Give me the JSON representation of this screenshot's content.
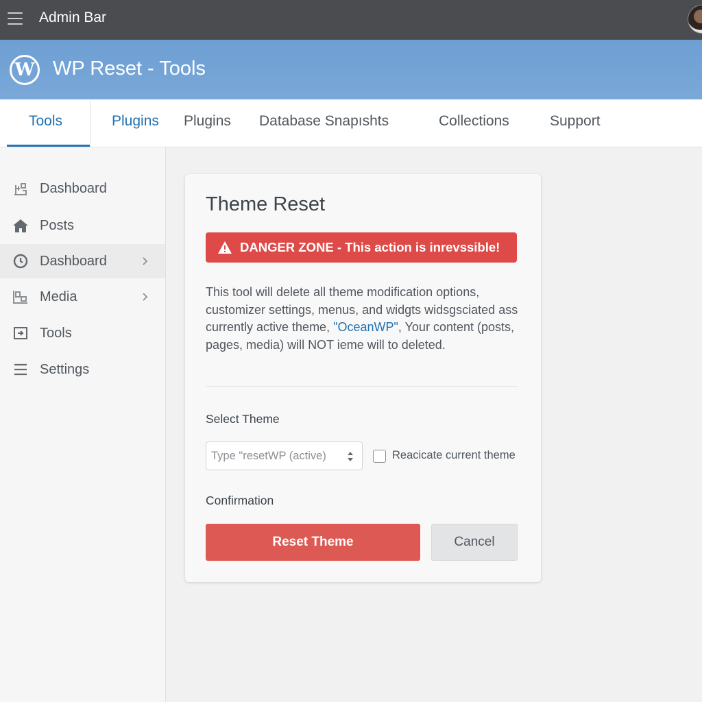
{
  "admin_bar": {
    "title": "Admin Bar",
    "menu_icon": "hamburger-icon",
    "avatar_icon": "user-avatar"
  },
  "header": {
    "logo_glyph": "W",
    "title": "WP Reset - Tools"
  },
  "tabs": [
    {
      "label": "Tools",
      "active": true
    },
    {
      "label": "Plugins"
    },
    {
      "label": "Plugins"
    },
    {
      "label": "Database Snapıshts"
    },
    {
      "label": "Collections"
    },
    {
      "label": "Support"
    }
  ],
  "sidebar": {
    "items": [
      {
        "label": "Dashboard",
        "icon": "dashboard-icon"
      },
      {
        "label": "Posts",
        "icon": "home-icon"
      },
      {
        "label": "Dashboard",
        "icon": "clock-icon",
        "chevron": true,
        "highlighted": true
      },
      {
        "label": "Media",
        "icon": "media-icon",
        "chevron": true
      },
      {
        "label": "Tools",
        "icon": "tools-icon"
      },
      {
        "label": "Settings",
        "icon": "settings-icon"
      }
    ]
  },
  "card": {
    "title": "Theme Reset",
    "danger": {
      "icon": "warning-icon",
      "text": "DANGER ZONE - This action is inrevssible!"
    },
    "description": {
      "part1": "This tool will delete all theme modification options, customizer settings, menus, and widgts widsgsciated ass currently active theme, ",
      "theme_name": "\"OceanWP\"",
      "part2": ", Your content (posts, pages, media) will NOT ieme will to deleted."
    },
    "select_theme_label": "Select Theme",
    "select_theme_value": "Type \"resetWP (active)",
    "checkbox_label": "Reacicate current theme",
    "checkbox_checked": false,
    "confirmation_label": "Confirmation",
    "reset_button": "Reset Theme",
    "cancel_button": "Cancel"
  },
  "colors": {
    "admin_bar": "#4a4c4f",
    "header": "#75a5d6",
    "accent": "#2271b1",
    "danger": "#de4a47",
    "reset_button": "#dd5a54"
  }
}
